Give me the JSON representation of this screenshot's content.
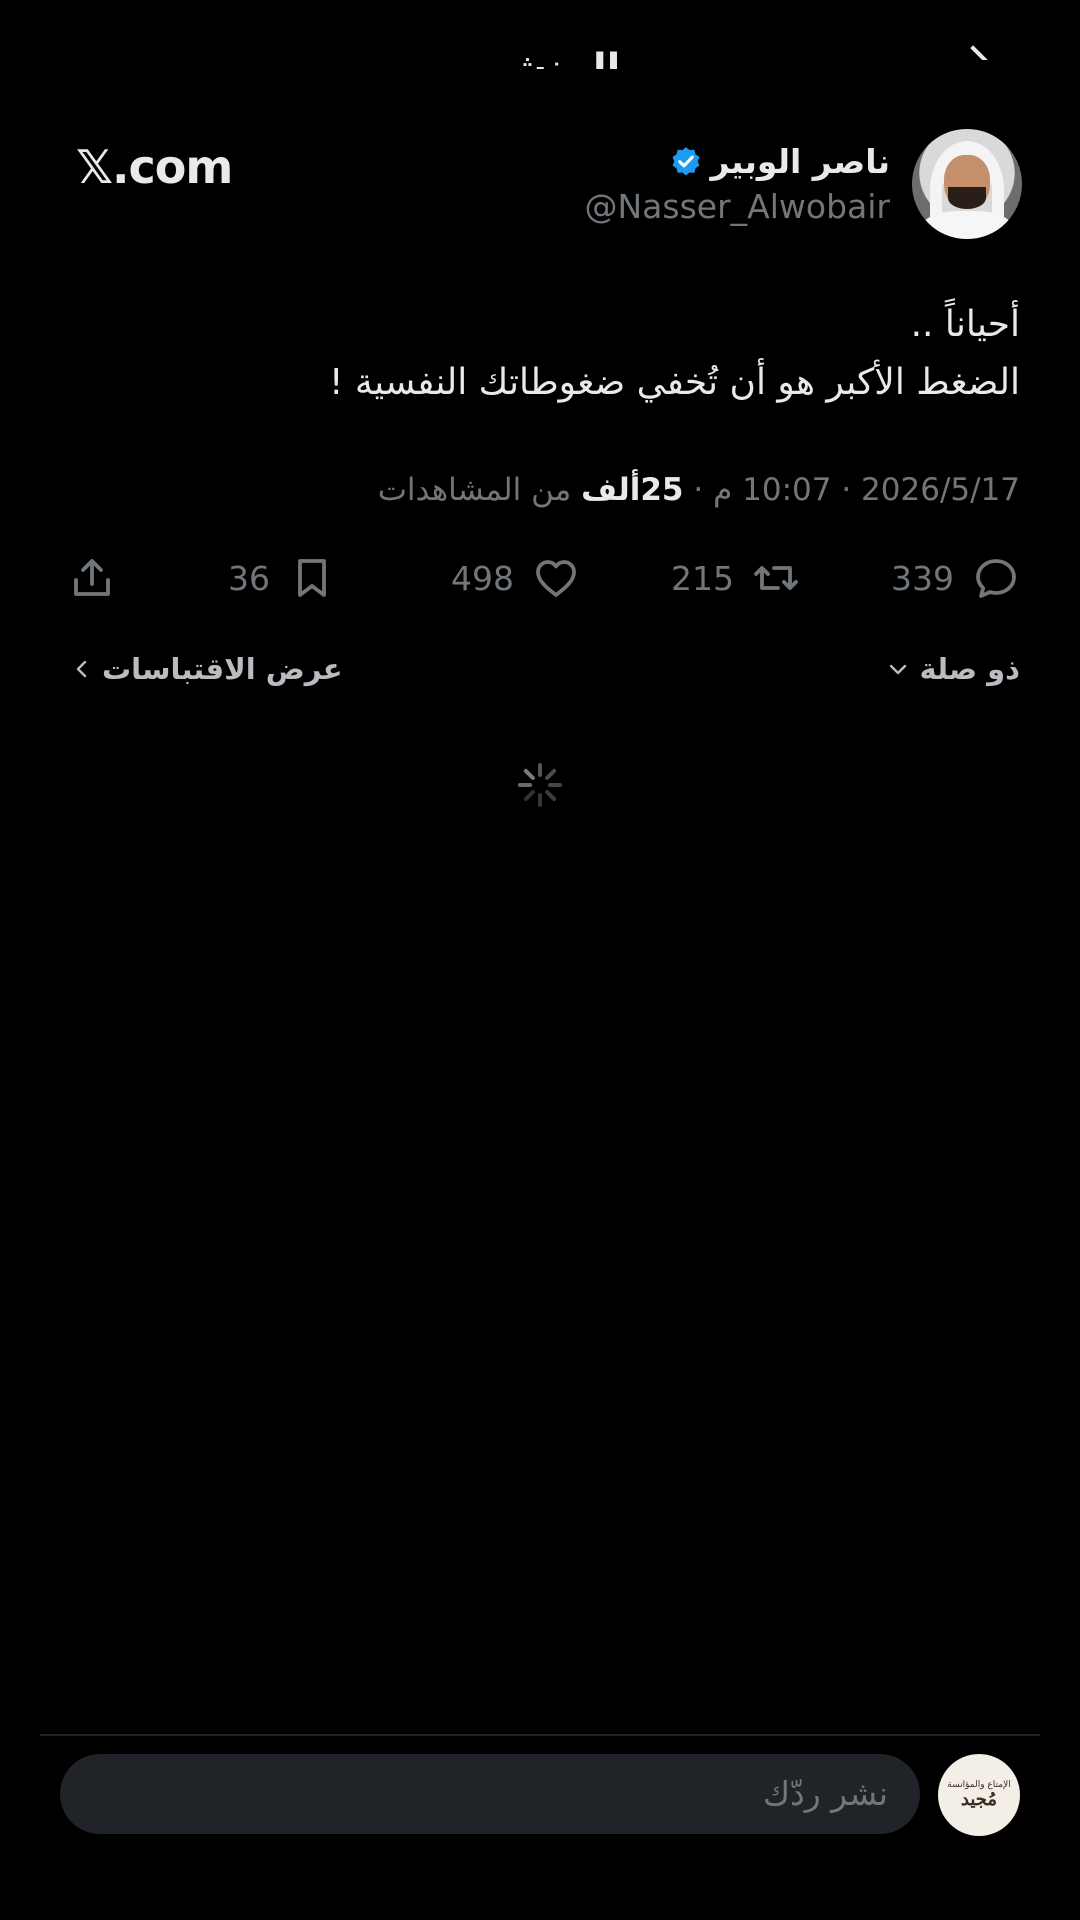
{
  "header": {
    "title": "المنشور"
  },
  "brand": {
    "label": "𝕏.com"
  },
  "author": {
    "display_name": "ناصر الوبير",
    "handle": "@Nasser_Alwobair",
    "verified": true,
    "verified_color": "#1d9bf0"
  },
  "tweet": {
    "line1": "أحياناً ..",
    "line2": "الضغط الأكبر هو أن تُخفي ضغوطاتك النفسية !",
    "date": "2026/5/17",
    "time": "10:07 م",
    "views_count": "25ألف",
    "views_label": "من المشاهدات",
    "separator": "·"
  },
  "actions": {
    "replies": "339",
    "reposts": "215",
    "likes": "498",
    "bookmarks": "36"
  },
  "subrow": {
    "related_label": "ذو صلة",
    "quotes_label": "عرض الاقتباسات"
  },
  "reply_bar": {
    "placeholder": "نشر ردّك",
    "avatar_text_small": "الإمتاع والمؤانسة",
    "avatar_text_big": "مُجيد"
  },
  "colors": {
    "background": "#000000",
    "text": "#e7e9ea",
    "muted": "#71767b",
    "input_bg": "#202327"
  }
}
